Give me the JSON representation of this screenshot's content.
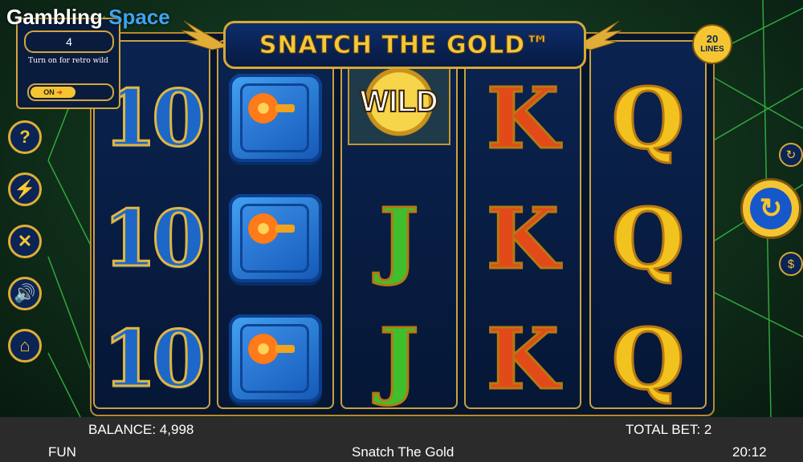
{
  "brand": {
    "part1": "Gambling",
    "part2": "Space"
  },
  "game_title": "SNATCH THE GOLD™",
  "lines": {
    "number": "20",
    "label": "LINES"
  },
  "feature_panel": {
    "value": "4",
    "caption": "Turn on for retro wild",
    "toggle_label": "ON"
  },
  "side_buttons": [
    "help-icon",
    "lightning-icon",
    "settings-icon",
    "sound-icon",
    "home-icon"
  ],
  "reels": [
    [
      "10",
      "10",
      "10"
    ],
    [
      "safe",
      "safe",
      "safe"
    ],
    [
      "WILD",
      "J",
      "J"
    ],
    [
      "K",
      "K",
      "K"
    ],
    [
      "Q",
      "Q",
      "Q"
    ]
  ],
  "bottom": {
    "balance": "BALANCE: 4,998",
    "total_bet": "TOTAL BET: 2",
    "mode": "FUN",
    "game_name": "Snatch The Gold",
    "time": "20:12"
  },
  "colors": {
    "gold": "#d8a934",
    "navy": "#0b2456",
    "spin_blue": "#1658c9"
  }
}
